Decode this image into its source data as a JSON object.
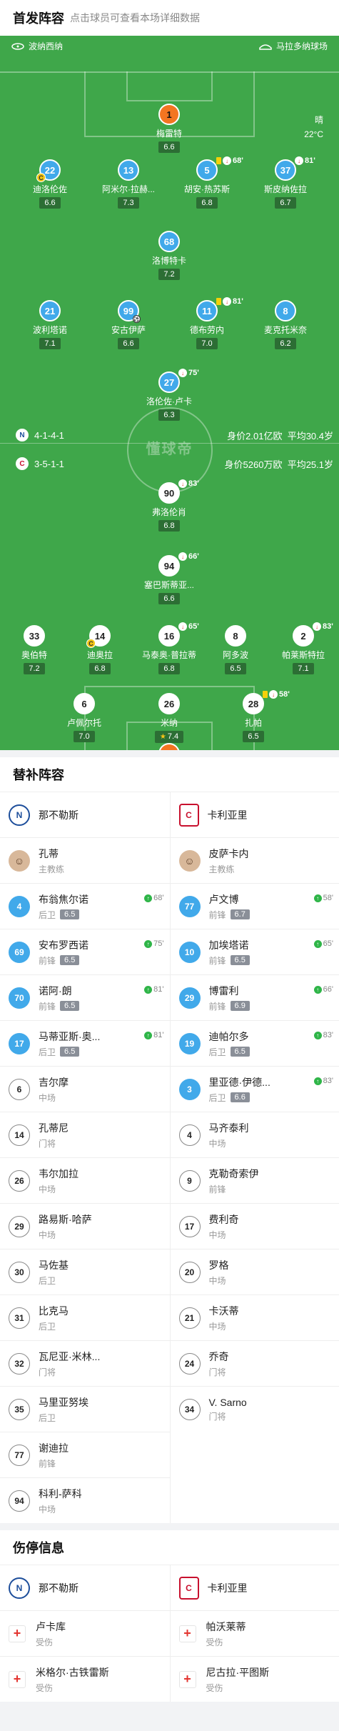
{
  "header": {
    "title": "首发阵容",
    "subtitle": "点击球员可查看本场详细数据"
  },
  "venue": {
    "home": "波纳西纳",
    "away": "马拉多纳球场"
  },
  "weather": {
    "cond": "晴",
    "temp": "22°C"
  },
  "watermark": "懂球帝",
  "home_team": {
    "name": "卡利亚里",
    "formation": "3-5-1-1",
    "value": "身价5260万欧",
    "age": "平均25.1岁"
  },
  "away_team": {
    "name": "那不勒斯",
    "formation": "4-1-4-1",
    "value": "身价2.01亿欧",
    "age": "平均30.4岁"
  },
  "cagliari_players": [
    {
      "num": "1",
      "name": "卡普里莱",
      "rating": "7.4",
      "style": "orange"
    },
    {
      "num": "6",
      "name": "卢佩尔托",
      "rating": "7.0",
      "style": "white"
    },
    {
      "num": "26",
      "name": "米纳",
      "rating": "7.4",
      "style": "white",
      "star": true
    },
    {
      "num": "28",
      "name": "扎帕",
      "rating": "6.5",
      "style": "white",
      "sub": "58'",
      "yellow": true
    },
    {
      "num": "33",
      "name": "奥伯特",
      "rating": "7.2",
      "style": "white"
    },
    {
      "num": "14",
      "name": "迪奥拉",
      "rating": "6.8",
      "style": "white",
      "captain": true
    },
    {
      "num": "16",
      "name": "马泰奥·普拉蒂",
      "rating": "6.8",
      "style": "white",
      "sub": "65'"
    },
    {
      "num": "8",
      "name": "阿多波",
      "rating": "6.5",
      "style": "white"
    },
    {
      "num": "2",
      "name": "帕莱斯特拉",
      "rating": "7.1",
      "style": "white",
      "sub": "83'"
    },
    {
      "num": "94",
      "name": "塞巴斯蒂亚...",
      "rating": "6.6",
      "style": "white",
      "sub": "66'"
    },
    {
      "num": "90",
      "name": "弗洛伦肖",
      "rating": "6.8",
      "style": "white",
      "sub": "83'"
    }
  ],
  "napoli_players": [
    {
      "num": "1",
      "name": "梅雷特",
      "rating": "6.6",
      "style": "orange"
    },
    {
      "num": "22",
      "name": "迪洛伦佐",
      "rating": "6.6",
      "style": "blue",
      "captain": true
    },
    {
      "num": "13",
      "name": "阿米尔·拉赫...",
      "rating": "7.3",
      "style": "blue"
    },
    {
      "num": "5",
      "name": "胡安·热苏斯",
      "rating": "6.8",
      "style": "blue",
      "sub": "68'",
      "yellow": true
    },
    {
      "num": "37",
      "name": "斯皮纳佐拉",
      "rating": "6.7",
      "style": "blue",
      "sub": "81'"
    },
    {
      "num": "68",
      "name": "洛博特卡",
      "rating": "7.2",
      "style": "blue"
    },
    {
      "num": "21",
      "name": "波利塔诺",
      "rating": "7.1",
      "style": "blue"
    },
    {
      "num": "99",
      "name": "安古伊萨",
      "rating": "6.6",
      "style": "blue",
      "goal": true
    },
    {
      "num": "11",
      "name": "德布劳内",
      "rating": "7.0",
      "style": "blue",
      "sub": "81'",
      "yellow": true
    },
    {
      "num": "8",
      "name": "麦克托米奈",
      "rating": "6.2",
      "style": "blue"
    },
    {
      "num": "27",
      "name": "洛伦佐·卢卡",
      "rating": "6.3",
      "style": "blue",
      "sub": "75'"
    }
  ],
  "subs": {
    "title": "替补阵容",
    "napoli": {
      "team": "那不勒斯",
      "coach": "孔蒂",
      "coach_role": "主教练",
      "players": [
        {
          "num": "4",
          "name": "布翁焦尔诺",
          "pos": "后卫",
          "rating": "6.5",
          "time": "68'",
          "sub_in": true
        },
        {
          "num": "69",
          "name": "安布罗西诺",
          "pos": "前锋",
          "rating": "6.5",
          "time": "75'",
          "sub_in": true
        },
        {
          "num": "70",
          "name": "诺阿·朗",
          "pos": "前锋",
          "rating": "6.5",
          "time": "81'",
          "sub_in": true
        },
        {
          "num": "17",
          "name": "马蒂亚斯·奥...",
          "pos": "后卫",
          "rating": "6.5",
          "time": "81'",
          "sub_in": true
        },
        {
          "num": "6",
          "name": "吉尔摩",
          "pos": "中场"
        },
        {
          "num": "14",
          "name": "孔蒂尼",
          "pos": "门将"
        },
        {
          "num": "26",
          "name": "韦尔加拉",
          "pos": "中场"
        },
        {
          "num": "29",
          "name": "路易斯·哈萨",
          "pos": "中场"
        },
        {
          "num": "30",
          "name": "马佐基",
          "pos": "后卫"
        },
        {
          "num": "31",
          "name": "比克马",
          "pos": "后卫"
        },
        {
          "num": "32",
          "name": "瓦尼亚·米林...",
          "pos": "门将"
        },
        {
          "num": "35",
          "name": "马里亚努埃",
          "pos": "后卫"
        },
        {
          "num": "77",
          "name": "谢迪拉",
          "pos": "前锋"
        },
        {
          "num": "94",
          "name": "科利-萨科",
          "pos": "中场"
        }
      ]
    },
    "cagliari": {
      "team": "卡利亚里",
      "coach": "皮萨卡内",
      "coach_role": "主教练",
      "players": [
        {
          "num": "77",
          "name": "卢文博",
          "pos": "前锋",
          "rating": "6.7",
          "time": "58'",
          "sub_in": true
        },
        {
          "num": "10",
          "name": "加埃塔诺",
          "pos": "前锋",
          "rating": "6.5",
          "time": "65'",
          "sub_in": true
        },
        {
          "num": "29",
          "name": "博雷利",
          "pos": "前锋",
          "rating": "6.9",
          "time": "66'",
          "sub_in": true
        },
        {
          "num": "19",
          "name": "迪帕尔多",
          "pos": "后卫",
          "rating": "6.5",
          "time": "83'",
          "sub_in": true
        },
        {
          "num": "3",
          "name": "里亚德·伊德...",
          "pos": "后卫",
          "rating": "6.6",
          "time": "83'",
          "sub_in": true
        },
        {
          "num": "4",
          "name": "马齐泰利",
          "pos": "中场"
        },
        {
          "num": "9",
          "name": "克勒奇索伊",
          "pos": "前锋"
        },
        {
          "num": "17",
          "name": "费利奇",
          "pos": "中场"
        },
        {
          "num": "20",
          "name": "罗格",
          "pos": "中场"
        },
        {
          "num": "21",
          "name": "卡沃蒂",
          "pos": "中场"
        },
        {
          "num": "24",
          "name": "乔奇",
          "pos": "门将"
        },
        {
          "num": "34",
          "name": "V. Sarno",
          "pos": "门将"
        }
      ]
    }
  },
  "injuries": {
    "title": "伤停信息",
    "napoli": {
      "team": "那不勒斯",
      "players": [
        {
          "name": "卢卡库",
          "status": "受伤"
        },
        {
          "name": "米格尔·古铁雷斯",
          "status": "受伤"
        }
      ]
    },
    "cagliari": {
      "team": "卡利亚里",
      "players": [
        {
          "name": "帕沃莱蒂",
          "status": "受伤"
        },
        {
          "name": "尼古拉·平图斯",
          "status": "受伤"
        }
      ]
    }
  }
}
